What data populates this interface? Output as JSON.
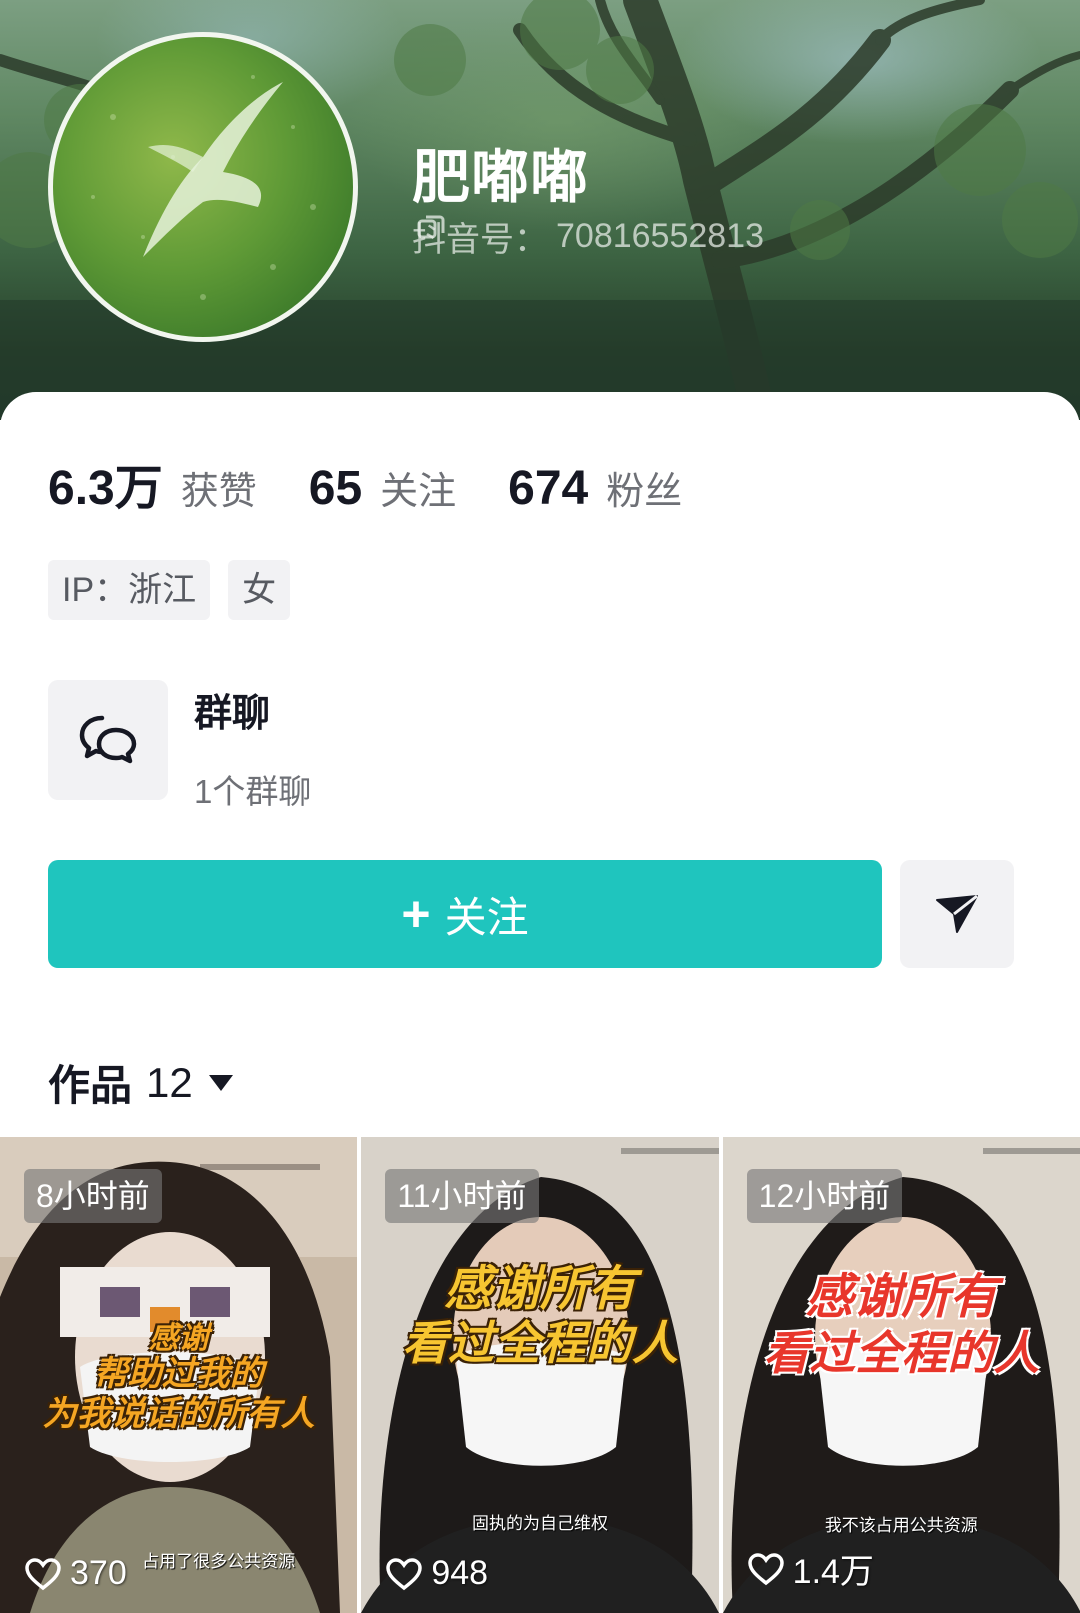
{
  "profile": {
    "username": "肥嘟嘟",
    "douyin_id_label": "抖音号：",
    "douyin_id": "70816552813"
  },
  "stats": [
    {
      "value": "6.3万",
      "label": "获赞"
    },
    {
      "value": "65",
      "label": "关注"
    },
    {
      "value": "674",
      "label": "粉丝"
    }
  ],
  "tags": {
    "ip": "IP：浙江",
    "gender": "女"
  },
  "group_chat": {
    "title": "群聊",
    "subtitle": "1个群聊",
    "icon": "chat-bubbles-icon"
  },
  "actions": {
    "follow_label": "关注",
    "follow_prefix": "+",
    "send_icon": "send-icon",
    "accent_color": "#1fc5be"
  },
  "works": {
    "label": "作品",
    "count": "12"
  },
  "videos": [
    {
      "time": "8小时前",
      "caption_lines": [
        "感谢",
        "帮助过我的",
        "为我说话的所有人"
      ],
      "caption_color": "#f5a623",
      "sub_caption": "占用了很多公共资源",
      "likes": "370"
    },
    {
      "time": "11小时前",
      "caption_lines": [
        "感谢所有",
        "看过全程的人"
      ],
      "caption_color": "#f7c531",
      "sub_caption": "固执的为自己维权",
      "likes": "948"
    },
    {
      "time": "12小时前",
      "caption_lines": [
        "感谢所有",
        "看过全程的人"
      ],
      "caption_color": "#e8362b",
      "sub_caption": "我不该占用公共资源",
      "likes": "1.4万"
    }
  ]
}
